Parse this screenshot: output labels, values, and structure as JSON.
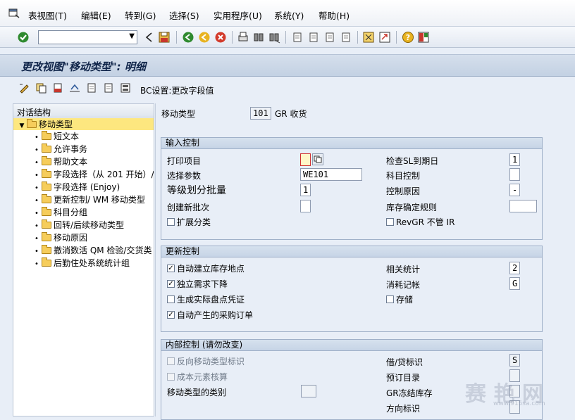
{
  "menubar": {
    "items": [
      "表视图(T)",
      "编辑(E)",
      "转到(G)",
      "选择(S)",
      "实用程序(U)",
      "系统(Y)",
      "帮助(H)"
    ]
  },
  "toolbar": {
    "command_value": "",
    "icons": [
      "enter-icon",
      "back-icon",
      "save-icon",
      "back-green-icon",
      "exit-icon",
      "cancel-icon",
      "print-icon",
      "find-icon",
      "find-next-icon",
      "first-page-icon",
      "prev-page-icon",
      "next-page-icon",
      "last-page-icon",
      "create-session-icon",
      "shortcut-icon",
      "help-icon",
      "layout-icon"
    ]
  },
  "title": "更改视图\"移动类型\": 明细",
  "app_toolbar": {
    "bc_label": "BC设置:更改字段值"
  },
  "tree": {
    "header": "对话结构",
    "root": "移动类型",
    "items": [
      "短文本",
      "允许事务",
      "帮助文本",
      "字段选择（从 201 开始）/",
      "字段选择 (Enjoy)",
      "更新控制/ WM 移动类型",
      "科目分组",
      "回转/后续移动类型",
      "移动原因",
      "撤消数活 QM 检验/交货类",
      "后勤住处系统统计组"
    ]
  },
  "header_fields": {
    "movement_type_label": "移动类型",
    "movement_type_value": "101",
    "movement_type_text": "GR 收货"
  },
  "input_control": {
    "title": "输入控制",
    "print_item_label": "打印项目",
    "print_item_value": "",
    "sel_param_label": "选择参数",
    "sel_param_value": "WE101",
    "batch_split_label": "等级划分批量",
    "batch_split_value": "1",
    "create_batch_label": "创建新批次",
    "create_batch_value": "",
    "ext_class_label": "扩展分类",
    "ext_class_checked": false,
    "check_sl_label": "检查SL到期日",
    "check_sl_value": "1",
    "account_ctrl_label": "科目控制",
    "account_ctrl_value": "",
    "ctrl_reason_label": "控制原因",
    "ctrl_reason_value": "-",
    "stock_rule_label": "库存确定规则",
    "stock_rule_value": "",
    "revgr_label": "RevGR 不管 IR",
    "revgr_checked": false
  },
  "update_control": {
    "title": "更新控制",
    "auto_sloc_label": "自动建立库存地点",
    "auto_sloc_checked": true,
    "indep_req_label": "独立需求下降",
    "indep_req_checked": true,
    "phys_inv_label": "生成实际盘点凭证",
    "phys_inv_checked": false,
    "auto_po_label": "自动产生的采购订单",
    "auto_po_checked": true,
    "stats_label": "相关统计",
    "stats_value": "2",
    "consumption_label": "消耗记帐",
    "consumption_value": "G",
    "store_label": "存储",
    "store_checked": false
  },
  "internal_control": {
    "title": "内部控制 (请勿改变)",
    "reverse_label": "反向移动类型标识",
    "reverse_checked": false,
    "cost_elem_label": "成本元素核算",
    "cost_elem_checked": false,
    "mvt_category_label": "移动类型的类别",
    "mvt_category_value": "",
    "debit_credit_label": "借/贷标识",
    "debit_credit_value": "S",
    "reservation_label": "预订目录",
    "reservation_value": "",
    "gr_blocked_label": "GR冻结库存",
    "gr_blocked_value": "",
    "direction_label": "方向标识",
    "direction_value": ""
  },
  "watermark": {
    "text": "赛 艳 网",
    "url": "www.915sa.com"
  }
}
